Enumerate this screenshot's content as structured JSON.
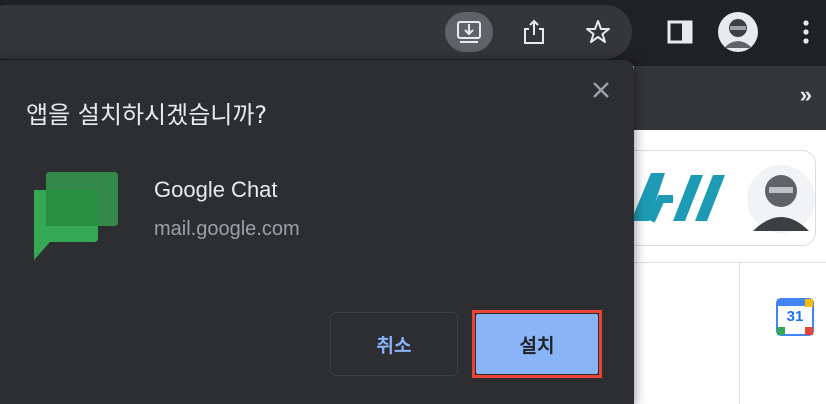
{
  "dialog": {
    "title": "앱을 설치하시겠습니까?",
    "app_name": "Google Chat",
    "app_origin": "mail.google.com",
    "cancel_label": "취소",
    "install_label": "설치"
  },
  "toolbar": {
    "icons": [
      "install-app-icon",
      "share-icon",
      "bookmark-star-icon",
      "reading-list-icon",
      "profile-avatar",
      "more-menu-icon"
    ],
    "overflow_label": "»"
  },
  "calendar_badge": "31",
  "colors": {
    "chrome_bg": "#202124",
    "dialog_bg": "#2d2e31",
    "accent": "#8ab4f8",
    "highlight": "#ea4335",
    "chat_green": "#34a853"
  }
}
